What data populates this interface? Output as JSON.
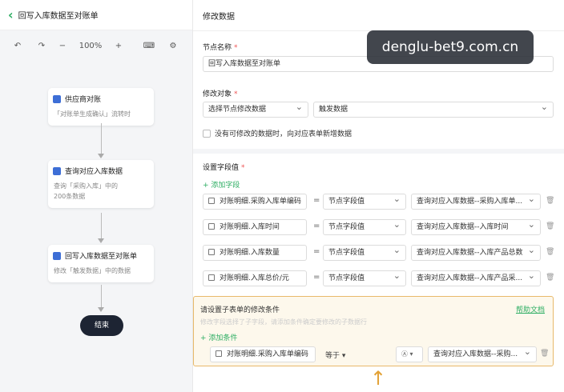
{
  "header": {
    "title": "回写入库数据至对账单"
  },
  "toolbar": {
    "zoom": "100%",
    "minus": "−",
    "plus": "+"
  },
  "flow": {
    "nodes": [
      {
        "title": "供应商对账",
        "desc": "「对账单生成确认」流转时"
      },
      {
        "title": "查询对应入库数据",
        "desc": "查询「采购入库」中的200条数据"
      },
      {
        "title": "回写入库数据至对账单",
        "desc": "修改「触发数据」中的数据"
      }
    ],
    "end": "结束"
  },
  "panel": {
    "title": "修改数据",
    "node_name_label": "节点名称",
    "node_name_value": "回写入库数据至对账单",
    "modify_target_label": "修改对象",
    "target_select": "选择节点修改数据",
    "target_value": "触发数据",
    "checkbox_label": "没有可修改的数据时，向对应表单新增数据",
    "set_fields_label": "设置字段值",
    "add_field": "+ 添加字段",
    "field_rows": [
      {
        "field": "对账明细.采购入库单编码",
        "eq": "=",
        "type": "节点字段值",
        "value": "查询对应入库数据--采购入库单..."
      },
      {
        "field": "对账明细.入库时间",
        "eq": "=",
        "type": "节点字段值",
        "value": "查询对应入库数据--入库时间"
      },
      {
        "field": "对账明细.入库数量",
        "eq": "=",
        "type": "节点字段值",
        "value": "查询对应入库数据--入库产品总数"
      },
      {
        "field": "对账明细.入库总价/元",
        "eq": "=",
        "type": "节点字段值",
        "value": "查询对应入库数据--入库产品采..."
      }
    ],
    "condition": {
      "title": "请设置子表单的修改条件",
      "help": "帮助文档",
      "hint": "修改字段选择了子字段，请添加条件确定要修改的子数据行",
      "add": "+ 添加条件",
      "field": "对账明细.采购入库单编码",
      "op": "等于",
      "value": "查询对应入库数据--采购..."
    }
  },
  "watermark": "denglu-bet9.com.cn",
  "colors": {
    "accent": "#2eae63",
    "node_icon": "#3d6ed6",
    "end_node": "#1d2433",
    "highlight_border": "#e8b96b",
    "arrow": "#e2a135"
  }
}
